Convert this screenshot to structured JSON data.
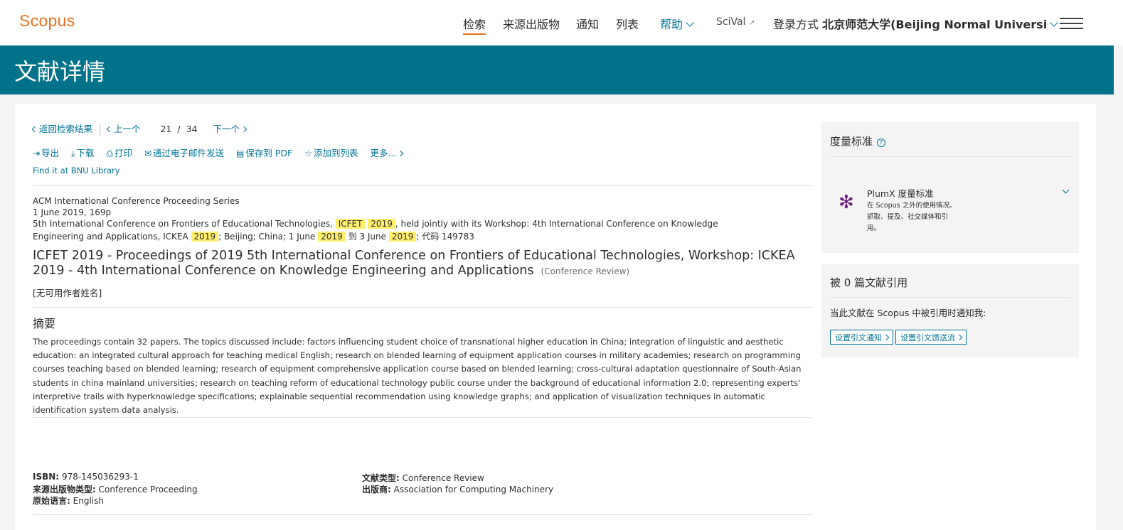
{
  "header": {
    "logo": "Scopus",
    "nav": {
      "search": "检索",
      "sources": "来源出版物",
      "alerts": "通知",
      "lists": "列表",
      "help": "帮助",
      "scival": "SciVal",
      "scival_icon": "↗",
      "login_prefix": "登录方式",
      "login_org": "北京师范大学(Beijing Normal Universi"
    }
  },
  "page": {
    "title": "文献详情"
  },
  "navigation": {
    "back": "返回检索结果",
    "prev": "上一个",
    "current": "21",
    "slash": "/",
    "total": "34",
    "next": "下一个"
  },
  "toolbar": {
    "export": "导出",
    "download": "下载",
    "print": "打印",
    "email": "通过电子邮件发送",
    "pdf": "保存到 PDF",
    "addlist": "添加到列表",
    "more": "更多..."
  },
  "library_link": "Find it at BNU Library",
  "meta": {
    "series": "ACM International Conference Proceeding Series",
    "date_pages": "1 June 2019, 169p",
    "line3_a": "5th International Conference on Frontiers of Educational Technologies,",
    "line3_icfet": "ICFET",
    "line3_year": "2019",
    "line3_b": ", held jointly with its Workshop: 4th International Conference on Knowledge",
    "line4_a": "Engineering and Applications, ICKEA",
    "line4_year1": "2019",
    "line4_b": "; Beijing; China; 1 June",
    "line4_year2": "2019",
    "line4_c": "到 3 June",
    "line4_year3": "2019",
    "line4_d": "; 代码 149783"
  },
  "document": {
    "title": "ICFET 2019 - Proceedings of 2019 5th International Conference on Frontiers of Educational Technologies, Workshop: ICKEA 2019 - 4th International Conference on Knowledge Engineering and Applications",
    "type": "(Conference Review)",
    "authors": "[无可用作者姓名]"
  },
  "abstract": {
    "heading": "摘要",
    "text": "The proceedings contain 32 papers. The topics discussed include: factors influencing student choice of transnational higher education in China; integration of linguistic and aesthetic education: an integrated cultural approach for teaching medical English; research on blended learning of equipment application courses in military academies; research on programming courses teaching based on blended learning; research of equipment comprehensive application course based on blended learning; cross-cultural adaptation questionnaire of South-Asian students in china mainland universities; research on teaching reform of educational technology public course under the background of educational information 2.0; representing experts' interpretive trails with hyperknowledge specifications; explainable sequential recommendation using knowledge graphs; and application of visualization techniques in automatic identification system data analysis."
  },
  "fields": {
    "isbn_label": "ISBN:",
    "isbn": "978-145036293-1",
    "source_type_label": "来源出版物类型:",
    "source_type": "Conference Proceeding",
    "language_label": "原始语言:",
    "language": "English",
    "doc_type_label": "文献类型:",
    "doc_type": "Conference Review",
    "publisher_label": "出版商:",
    "publisher": "Association for Computing Machinery"
  },
  "sidebar": {
    "metrics_title": "度量标准",
    "help_icon": "?",
    "plumx_logo": "✻",
    "plumx_title": "PlumX 度量标准",
    "plumx_desc": "在 Scopus 之外的使用情况、抓取、提及、社交媒体和引用。",
    "cited_title": "被 0 篇文献引用",
    "cited_notify": "当此文献在 Scopus 中被引用时通知我:",
    "btn_alert": "设置引文通知",
    "btn_feed": "设置引文馈送流"
  },
  "colors": {
    "brand_orange": "#e9711c",
    "teal": "#00738a",
    "link": "#007398",
    "highlight": "#ffef6b",
    "plumx_purple": "#6e1e7f"
  }
}
